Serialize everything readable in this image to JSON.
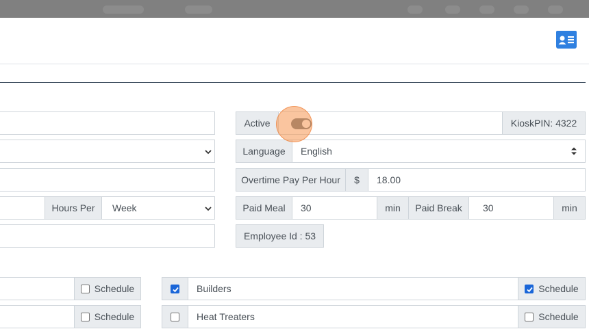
{
  "header": {
    "icon": "id-card-icon",
    "accent_color": "#2f80e0"
  },
  "profile": {
    "hours_per_label": "Hours Per",
    "hours_per_value": "Week",
    "active_label": "Active",
    "active_on": true,
    "kiosk_pin": "KioskPIN: 4322",
    "language_label": "Language",
    "language_value": "English",
    "overtime_label": "Overtime Pay Per Hour",
    "currency_symbol": "$",
    "overtime_value": "18.00",
    "paid_meal_label": "Paid Meal",
    "paid_meal_value": "30",
    "paid_meal_unit": "min",
    "paid_break_label": "Paid Break",
    "paid_break_value": "30",
    "paid_break_unit": "min",
    "employee_id": "Employee Id : 53"
  },
  "departments": {
    "left": [
      {
        "schedule_label": "Schedule",
        "schedule_checked": false
      },
      {
        "schedule_label": "Schedule",
        "schedule_checked": false
      }
    ],
    "right": [
      {
        "name": "Builders",
        "checked": true,
        "schedule_label": "Schedule",
        "schedule_checked": true
      },
      {
        "name": "Heat Treaters",
        "checked": false,
        "schedule_label": "Schedule",
        "schedule_checked": false
      }
    ]
  }
}
